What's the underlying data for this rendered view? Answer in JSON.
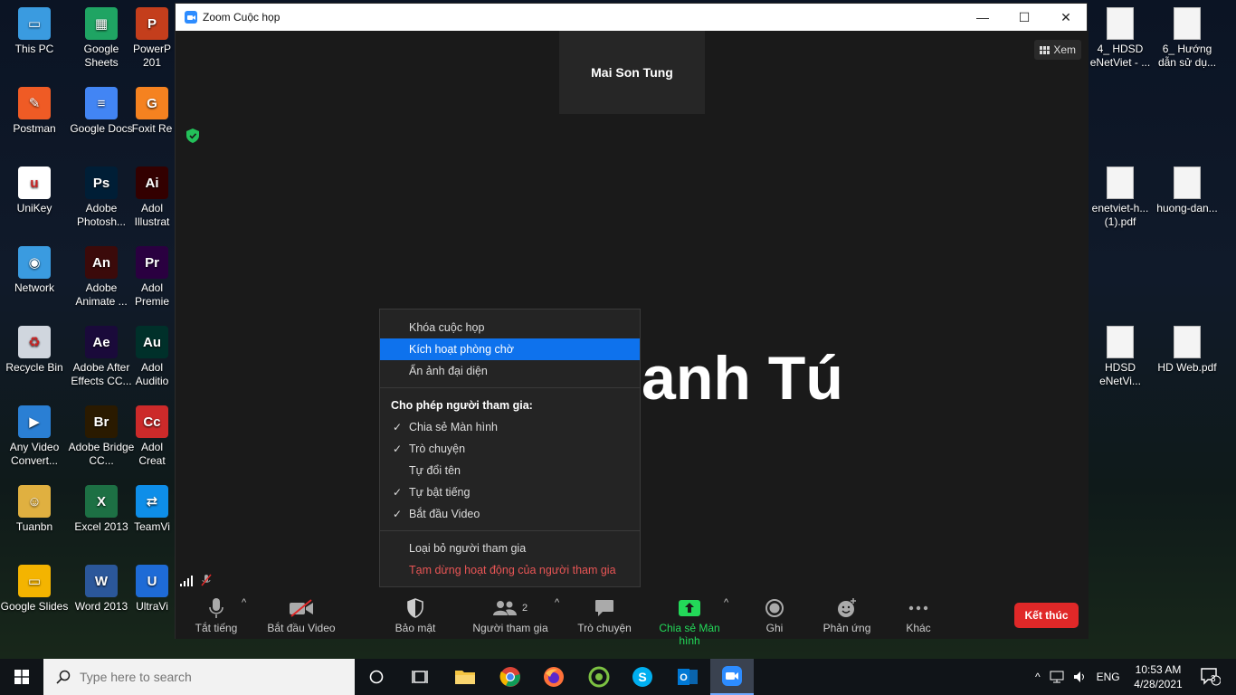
{
  "desktop": {
    "left_icons": [
      {
        "label": "This PC",
        "color": "#3a9be0",
        "glyph": "▭"
      },
      {
        "label": "Google Sheets",
        "color": "#1fa463",
        "glyph": "▦"
      },
      {
        "label": "PowerP 201",
        "color": "#c43e1c",
        "glyph": "P"
      },
      {
        "label": "Postman",
        "color": "#ef5b25",
        "glyph": "✎"
      },
      {
        "label": "Google Docs",
        "color": "#4285f4",
        "glyph": "≡"
      },
      {
        "label": "Foxit Re",
        "color": "#f58220",
        "glyph": "G"
      },
      {
        "label": "UniKey",
        "color": "#ffffff",
        "glyph": "u"
      },
      {
        "label": "Adobe Photosh...",
        "color": "#001e36",
        "glyph": "Ps"
      },
      {
        "label": "Adol Illustrat",
        "color": "#330000",
        "glyph": "Ai"
      },
      {
        "label": "Network",
        "color": "#3a9be0",
        "glyph": "◉"
      },
      {
        "label": "Adobe Animate ...",
        "color": "#3b0a0a",
        "glyph": "An"
      },
      {
        "label": "Adol Premie",
        "color": "#2a0040",
        "glyph": "Pr"
      },
      {
        "label": "Recycle Bin",
        "color": "#d0d6de",
        "glyph": "♻"
      },
      {
        "label": "Adobe After Effects CC...",
        "color": "#1a0a3a",
        "glyph": "Ae"
      },
      {
        "label": "Adol Auditio",
        "color": "#00302a",
        "glyph": "Au"
      },
      {
        "label": "Any Video Convert...",
        "color": "#2a7fd4",
        "glyph": "▶"
      },
      {
        "label": "Adobe Bridge CC...",
        "color": "#2a1a00",
        "glyph": "Br"
      },
      {
        "label": "Adol Creat",
        "color": "#cc2a2a",
        "glyph": "Cc"
      },
      {
        "label": "Tuanbn",
        "color": "#e0b040",
        "glyph": "☺"
      },
      {
        "label": "Excel 2013",
        "color": "#1d7044",
        "glyph": "X"
      },
      {
        "label": "TeamVi",
        "color": "#0e8ee9",
        "glyph": "⇄"
      },
      {
        "label": "Google Slides",
        "color": "#f4b400",
        "glyph": "▭"
      },
      {
        "label": "Word 2013",
        "color": "#2b579a",
        "glyph": "W"
      },
      {
        "label": "UltraVi",
        "color": "#1e6bd6",
        "glyph": "U"
      }
    ],
    "right_icons": [
      {
        "label": "4_ HDSD eNetViet - ..."
      },
      {
        "label": "6_ Hướng dẫn sử dụ..."
      },
      {
        "label": "enetviet-h... (1).pdf"
      },
      {
        "label": "huong-dan..."
      },
      {
        "label": "HDSD eNetVi..."
      },
      {
        "label": "HD Web.pdf"
      }
    ]
  },
  "zoom": {
    "title": "Zoom Cuộc họp",
    "controls": {
      "minimize": "—",
      "maximize": "☐",
      "close": "✕"
    },
    "thumbnail_name": "Mai Son Tung",
    "view_label": "Xem",
    "main_speaker_name": "anh Tú",
    "security_menu": {
      "items": [
        {
          "label": "Khóa cuộc họp",
          "checked": false,
          "highlighted": false
        },
        {
          "label": "Kích hoạt phòng chờ",
          "checked": false,
          "highlighted": true
        },
        {
          "label": "Ẩn ảnh đại diện",
          "checked": false,
          "highlighted": false
        }
      ],
      "allow_header": "Cho phép người tham gia:",
      "allow_items": [
        {
          "label": "Chia sẻ Màn hình",
          "check": "✓"
        },
        {
          "label": "Trò chuyện",
          "check": "✓"
        },
        {
          "label": "Tự đổi tên",
          "check": ""
        },
        {
          "label": "Tự bật tiếng",
          "check": "✓"
        },
        {
          "label": "Bắt đầu Video",
          "check": "✓"
        }
      ],
      "remove_label": "Loại bỏ người tham gia",
      "suspend_label": "Tạm dừng hoạt động của người tham gia"
    },
    "toolbar": {
      "mute_label": "Tắt tiếng",
      "video_label": "Bắt đầu Video",
      "security_label": "Bảo mật",
      "participants_label": "Người tham gia",
      "participants_count": "2",
      "chat_label": "Trò chuyện",
      "share_label": "Chia sẻ Màn hình",
      "record_label": "Ghi",
      "reactions_label": "Phản ứng",
      "more_label": "Khác",
      "end_label": "Kết thúc",
      "share_color": "#23d959",
      "end_color": "#e02828"
    }
  },
  "taskbar": {
    "search_placeholder": "Type here to search",
    "apps": [
      "file-explorer-icon",
      "chrome-icon",
      "firefox-icon",
      "coccoc-icon",
      "skype-icon",
      "outlook-icon",
      "zoom-icon"
    ],
    "tray": {
      "language": "ENG",
      "time": "10:53 AM",
      "date": "4/28/2021",
      "notifications": "3"
    }
  }
}
